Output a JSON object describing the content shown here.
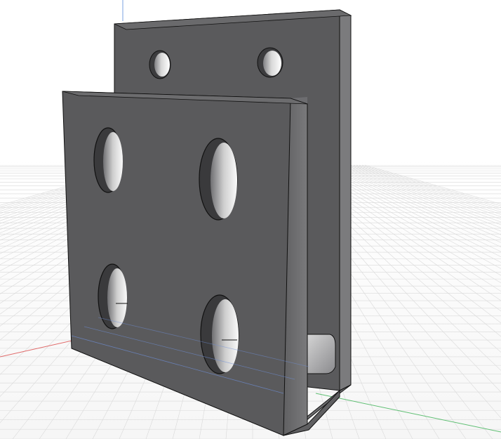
{
  "viewport": {
    "type": "cad-3d-view",
    "background": "#ffffff",
    "grid_color": "#d9d9d9",
    "axis_colors": {
      "x": "#e06a6a",
      "y": "#5fbf73",
      "z": "#7ba3e0"
    }
  },
  "model": {
    "part": "bracket",
    "face_color": "#5a5a5c",
    "side_color": "#6e6e70",
    "edge_color": "#111111",
    "hole_interior_light": "#f2f2f2",
    "hole_interior_dark": "#8f8f92",
    "front_plate_holes": 4,
    "back_plate_holes": 2
  }
}
